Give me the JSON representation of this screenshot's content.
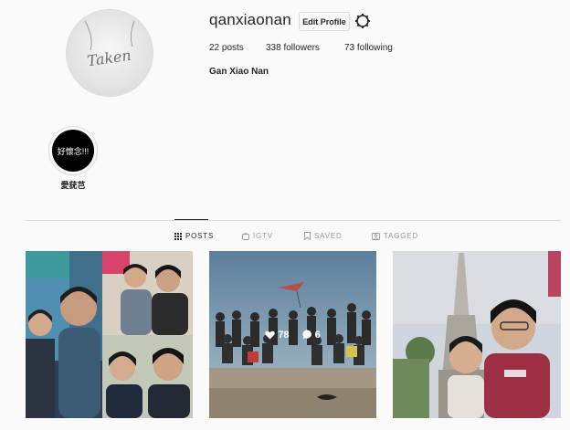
{
  "profile": {
    "username": "qanxiaonan",
    "edit_label": "Edit Profile",
    "avatar_text": "Taken",
    "full_name": "Gan Xiao Nan",
    "posts": "22 posts",
    "followers": "338 followers",
    "following": "73 following"
  },
  "highlights": [
    {
      "cover_text": "好懷念!!!",
      "label": "愛莸芑"
    }
  ],
  "tabs": [
    {
      "label": "POSTS",
      "icon": "grid-icon",
      "active": true
    },
    {
      "label": "IGTV",
      "icon": "igtv-icon",
      "active": false
    },
    {
      "label": "SAVED",
      "icon": "bookmark-icon",
      "active": false
    },
    {
      "label": "TAGGED",
      "icon": "tag-icon",
      "active": false
    }
  ],
  "posts": [
    {
      "subject": "collage-photo"
    },
    {
      "subject": "beach-group-photo",
      "likes": "78",
      "comments": "6"
    },
    {
      "subject": "temple-selfie"
    }
  ]
}
